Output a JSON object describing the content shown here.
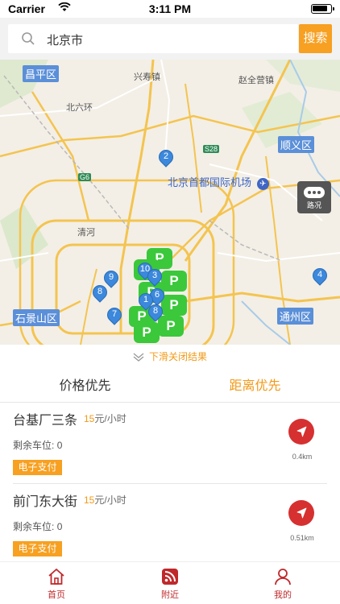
{
  "status_bar": {
    "carrier": "Carrier",
    "time": "3:11 PM"
  },
  "search": {
    "value": "北京市",
    "button_label": "搜索"
  },
  "map": {
    "districts": [
      "昌平区",
      "顺义区",
      "石景山区",
      "通州区"
    ],
    "places": [
      "兴寿镇",
      "赵全营镇",
      "北六环",
      "清河"
    ],
    "airport_label": "北京首都国际机场",
    "road_badges": [
      "S28",
      "G6"
    ],
    "traffic_label": "路况",
    "pins": [
      "2",
      "4",
      "9",
      "8",
      "7",
      "10",
      "3",
      "6",
      "1",
      "8"
    ],
    "parking_letter": "P"
  },
  "close_hint": "下滑关闭结果",
  "tabs": [
    {
      "label": "价格优先",
      "active": false
    },
    {
      "label": "距离优先",
      "active": true
    }
  ],
  "results": [
    {
      "name": "台基厂三条",
      "price": "15",
      "unit": "元/小时",
      "spaces_label": "剩余车位:",
      "spaces": "0",
      "pay_label": "电子支付",
      "distance": "0.4km"
    },
    {
      "name": "前门东大街",
      "price": "15",
      "unit": "元/小时",
      "spaces_label": "剩余车位:",
      "spaces": "0",
      "pay_label": "电子支付",
      "distance": "0.51km"
    }
  ],
  "bottom_nav": [
    {
      "label": "首页",
      "icon": "home-icon"
    },
    {
      "label": "附近",
      "icon": "nearby-icon"
    },
    {
      "label": "我的",
      "icon": "profile-icon"
    }
  ],
  "colors": {
    "accent": "#f7a021",
    "nav_red": "#c0282b",
    "pin_blue": "#3c88dc",
    "parking_green": "#3bc83b"
  }
}
